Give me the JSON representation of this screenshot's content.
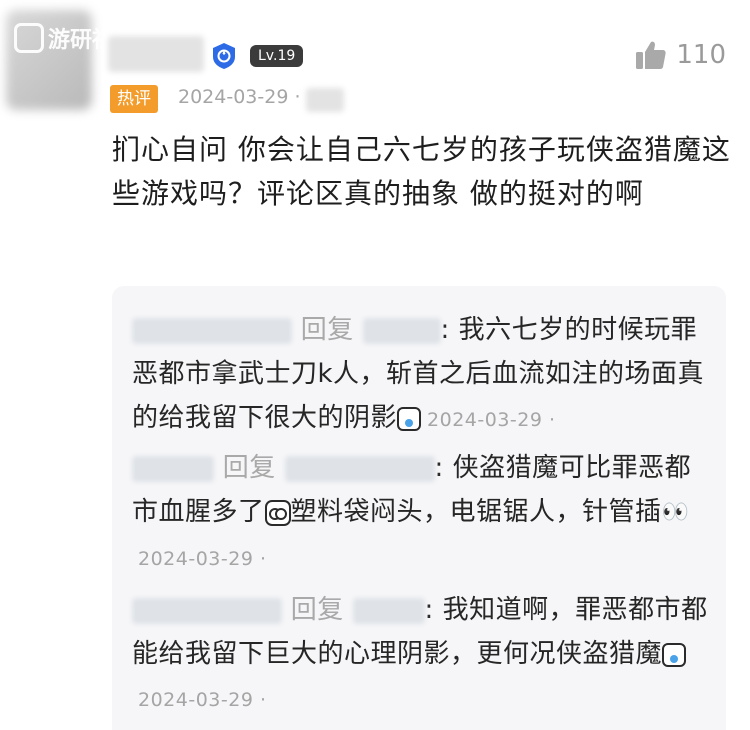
{
  "comment": {
    "level": "Lv.19",
    "like_count": "110",
    "hot_badge": "热评",
    "date": "2024-03-29 ·",
    "text": "扪心自问 你会让自己六七岁的孩子玩侠盗猎魔这些游戏吗？评论区真的抽象 做的挺对的啊",
    "watermark": "游研社"
  },
  "replies": [
    {
      "reply_word": "回复",
      "text_a": ": 我六七岁的时候玩罪恶都市拿武士刀k人，斩首之后血流如注的场面真的给我留下很大的阴影",
      "date": "2024-03-29 ·"
    },
    {
      "reply_word": "回复",
      "text_a": ": 侠盗猎魔可比罪恶都市血腥多了",
      "text_b": "塑料袋闷头，电锯锯人，针管插",
      "date": "2024-03-29 ·"
    },
    {
      "reply_word": "回复",
      "text_a": ": 我知道啊，罪恶都市都能给我留下巨大的心理阴影，更何况侠盗猎魔",
      "date": "2024-03-29 ·"
    }
  ],
  "icons": {
    "vip": "shield-badge-icon",
    "like": "thumbs-up-icon"
  },
  "colors": {
    "hot_badge": "#f39c2b",
    "vip_badge": "#2d6be6",
    "level_badge": "#3b3b3b",
    "muted": "#a5a5a5"
  }
}
